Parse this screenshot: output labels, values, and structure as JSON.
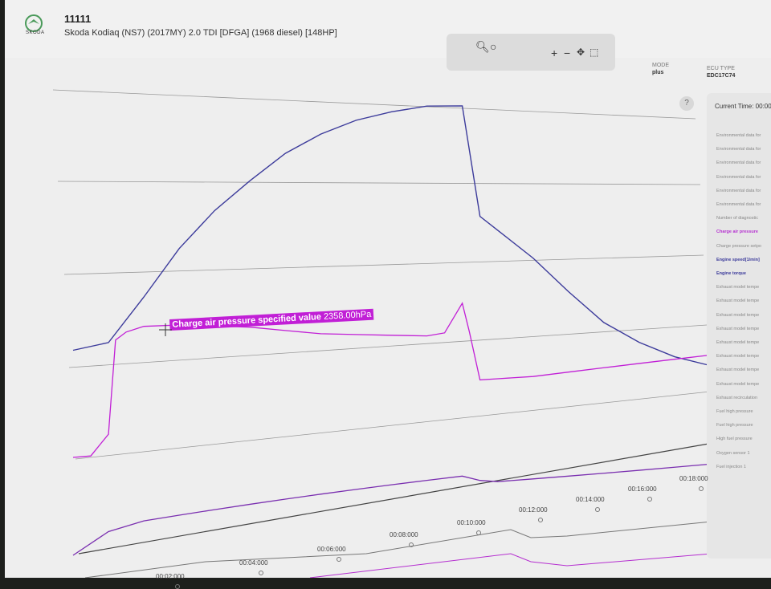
{
  "header": {
    "logo_text": "SKODA",
    "vehicle_id": "11111",
    "vehicle_desc": "Skoda Kodiaq (NS7) (2017MY) 2.0 TDI [DFGA] (1968 diesel) [148HP]"
  },
  "toolbar": {
    "icons": [
      "search-icon",
      "lasso-icon",
      "zoom-in-icon",
      "zoom-out-icon",
      "autoscale-icon",
      "reset-icon"
    ]
  },
  "meta": [
    {
      "label": "MODE",
      "value": "plus"
    },
    {
      "label": "ECU TYPE",
      "value": "EDC17C74"
    }
  ],
  "sidebar": {
    "current_time": "Current Time: 00:00",
    "items": [
      {
        "label": "Environmental data for",
        "style": "normal"
      },
      {
        "label": "Environmental data for",
        "style": "normal"
      },
      {
        "label": "Environmental data for",
        "style": "normal"
      },
      {
        "label": "Environmental data for",
        "style": "normal"
      },
      {
        "label": "Environmental data for",
        "style": "normal"
      },
      {
        "label": "Environmental data for",
        "style": "normal"
      },
      {
        "label": "Number of diagnostic",
        "style": "normal"
      },
      {
        "label": "Charge air pressure",
        "style": "magenta"
      },
      {
        "label": "Charge pressure setpo",
        "style": "normal"
      },
      {
        "label": "Engine speed[1/min]",
        "style": "blue"
      },
      {
        "label": "Engine torque",
        "style": "blue"
      },
      {
        "label": "Exhaust model tempe",
        "style": "normal"
      },
      {
        "label": "Exhaust model tempe",
        "style": "normal"
      },
      {
        "label": "Exhaust model tempe",
        "style": "normal"
      },
      {
        "label": "Exhaust model tempe",
        "style": "normal"
      },
      {
        "label": "Exhaust model tempe",
        "style": "normal"
      },
      {
        "label": "Exhaust model tempe",
        "style": "normal"
      },
      {
        "label": "Exhaust model tempe",
        "style": "normal"
      },
      {
        "label": "Exhaust model tempe",
        "style": "normal"
      },
      {
        "label": "Exhaust recirculation",
        "style": "normal"
      },
      {
        "label": "Fuel high pressure",
        "style": "normal"
      },
      {
        "label": "Fuel high pressure",
        "style": "normal"
      },
      {
        "label": "High fuel pressure",
        "style": "normal"
      },
      {
        "label": "Oxygen sensor 1",
        "style": "normal"
      },
      {
        "label": "Fuel injection 1",
        "style": "normal"
      }
    ]
  },
  "tooltip": {
    "label": "Charge air pressure specified value",
    "value": "2358.00hPa"
  },
  "help_label": "?",
  "chart_data": {
    "type": "line",
    "x_ticks": [
      "00:02:000",
      "00:04:000",
      "00:06:000",
      "00:08:000",
      "00:10:000",
      "00:12:000",
      "00:14:000",
      "00:16:000",
      "00:18:000"
    ],
    "series": [
      {
        "name": "Engine speed[1/min]",
        "color": "#3c3b9b",
        "x": [
          0,
          1,
          2,
          3,
          4,
          5,
          6,
          7,
          8,
          9,
          10,
          11,
          11.5,
          12,
          13,
          14,
          15,
          16,
          17,
          18
        ],
        "y": [
          0.1,
          0.13,
          0.3,
          0.48,
          0.62,
          0.73,
          0.83,
          0.9,
          0.95,
          0.98,
          1.0,
          1.0,
          0.6,
          0.55,
          0.45,
          0.33,
          0.22,
          0.15,
          0.1,
          0.07
        ]
      },
      {
        "name": "Charge air pressure",
        "color": "#c11fd6",
        "x": [
          0,
          0.5,
          1,
          1.2,
          1.5,
          2,
          3,
          4,
          5,
          6,
          7,
          8,
          9,
          10,
          10.5,
          11,
          11.2,
          11.5,
          12,
          13,
          14,
          15,
          16,
          17,
          18
        ],
        "y": [
          0.0,
          0.0,
          0.08,
          0.45,
          0.48,
          0.5,
          0.5,
          0.49,
          0.48,
          0.46,
          0.44,
          0.43,
          0.42,
          0.41,
          0.42,
          0.55,
          0.42,
          0.2,
          0.2,
          0.2,
          0.21,
          0.22,
          0.23,
          0.24,
          0.25
        ]
      },
      {
        "name": "Engine torque",
        "color": "#7a2fb0",
        "x": [
          0,
          1,
          2,
          3,
          4,
          5,
          6,
          7,
          8,
          9,
          10,
          11,
          11.5,
          12,
          13,
          14,
          15,
          16,
          17,
          18
        ],
        "y": [
          0.0,
          0.4,
          0.55,
          0.6,
          0.65,
          0.7,
          0.75,
          0.8,
          0.85,
          0.9,
          0.95,
          1.0,
          0.8,
          0.7,
          0.68,
          0.66,
          0.64,
          0.62,
          0.6,
          0.58
        ]
      }
    ]
  }
}
